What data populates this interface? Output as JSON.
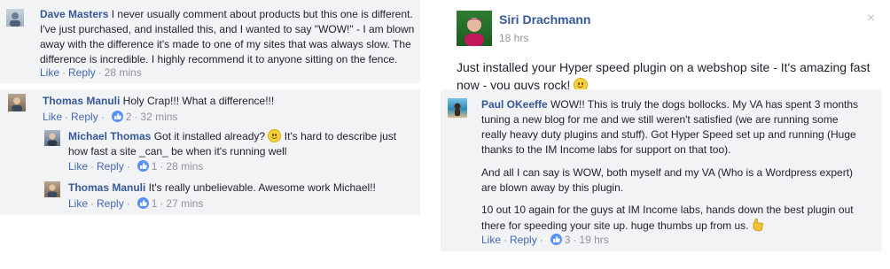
{
  "comments": [
    {
      "author": "Dave Masters",
      "lines": [
        " I never usually comment about products but this one is different.",
        "I've just purchased, and installed this, and I wanted to say \"WOW!\" - I am blown",
        "away with the difference it's made to one of my sites that was always slow. The",
        "difference is incredible. I highly recommend it to anyone sitting on the fence."
      ],
      "actions": {
        "like": "Like",
        "reply": "Reply",
        "time": "28 mins"
      }
    },
    {
      "author": "Thomas Manuli",
      "lines": [
        " Holy Crap!!! What a difference!!!"
      ],
      "actions": {
        "like": "Like",
        "reply": "Reply",
        "count": "2",
        "time": "32 mins"
      }
    },
    {
      "author": "Michael Thomas",
      "lines": [
        " Got it installed already? ",
        " It's hard to describe just",
        "how fast a site _can_ be when it's running well"
      ],
      "actions": {
        "like": "Like",
        "reply": "Reply",
        "count": "1",
        "time": "28 mins"
      }
    },
    {
      "author": "Thomas Manuli",
      "lines": [
        " It's really unbelievable. Awesome work Michael!!"
      ],
      "actions": {
        "like": "Like",
        "reply": "Reply",
        "count": "1",
        "time": "27 mins"
      }
    }
  ],
  "post": {
    "author": "Siri Drachmann",
    "time": "18 hrs",
    "lines": [
      "Just installed your Hyper speed plugin on a webshop site - It's amazing fast",
      "now - you guys rock! "
    ],
    "close_glyph": "×"
  },
  "post_comment": {
    "author": "Paul OKeeffe",
    "lines": [
      " WOW!! This is truly the dogs bollocks. My VA has spent 3 months",
      "tuning a new blog for me and we still weren't satisfied (we are running some",
      "really heavy duty plugins and stuff). Got Hyper Speed set up and running (Huge",
      "thanks to the IM Income labs for support on that too).",
      "And all I can say is WOW, both myself and my VA (Who is a Wordpress expert)",
      "are blown away by this plugin.",
      "10 out 10 again for the guys at IM Income labs, hands down the best plugin out",
      "there for speeding your site up. huge thumbs up from us. "
    ],
    "actions": {
      "like": "Like",
      "reply": "Reply",
      "count": "3",
      "time": "19 hrs"
    }
  },
  "colors": {
    "link": "#4267b2",
    "name": "#365899",
    "meta": "#90949c",
    "panel": "#f2f3f5"
  },
  "icons": [
    "avatar",
    "like-icon",
    "smile-emoji-icon",
    "thumbs-up-emoji-icon",
    "close-icon"
  ]
}
